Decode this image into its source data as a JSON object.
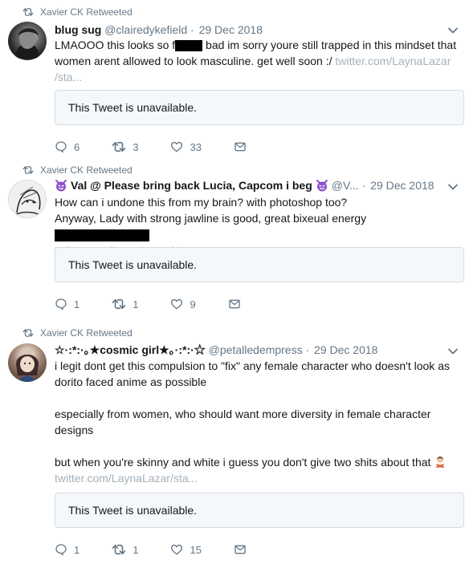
{
  "tweets": [
    {
      "retweeted_by": "Xavier CK Retweeted",
      "name": "blug sug",
      "handle": "@clairedykefield",
      "date": "29 Dec 2018",
      "text_a": "LMAOOO this looks so f",
      "text_b": " bad im sorry youre still trapped in this mindset that",
      "text_c": "women arent allowed to look masculine. get well soon :/ ",
      "link_a": "twitter.com/LaynaLazar",
      "link_b": "/sta...",
      "quote": "This Tweet is unavailable.",
      "replies": "6",
      "retweets": "3",
      "likes": "33"
    },
    {
      "retweeted_by": "Xavier CK Retweeted",
      "name": "Val @ Please bring back Lucia, Capcom i beg",
      "handle": "@V...",
      "date": "29 Dec 2018",
      "line_1": "How can i undone this from my brain? with photoshop too?",
      "line_2": "Anyway, Lady with strong jawline is good, great bixeual energy",
      "link": "twitter.com/LaynaLazar/sta...",
      "quote": "This Tweet is unavailable.",
      "replies": "1",
      "retweets": "1",
      "likes": "9"
    },
    {
      "retweeted_by": "Xavier CK Retweeted",
      "name": "☆·:*:·｡★cosmic girl★｡·:*:·☆",
      "handle": "@petalledempress",
      "date": "29 Dec 2018",
      "line_1": "i legit dont get this compulsion to \"fix\" any female character who doesn't look as",
      "line_2": "dorito faced anime as possible",
      "line_3": "especially from women, who should want more diversity in female character",
      "line_4": "designs",
      "line_5": "but when you're skinny and white i guess you don't give two shits about that",
      "link": "twitter.com/LaynaLazar/sta...",
      "quote": "This Tweet is unavailable.",
      "replies": "1",
      "retweets": "1",
      "likes": "15"
    }
  ],
  "colors": {
    "muted": "#657786",
    "link": "#a5b1bb",
    "quote_bg": "#f5f8fa",
    "quote_border": "#d3dce4",
    "devil_emoji": "#8e4fc8"
  },
  "icons": [
    "retweet-icon",
    "reply-icon",
    "like-icon",
    "dm-icon",
    "chevron-down-icon",
    "devil-emoji-icon",
    "person-gesturing-no-emoji-icon"
  ]
}
